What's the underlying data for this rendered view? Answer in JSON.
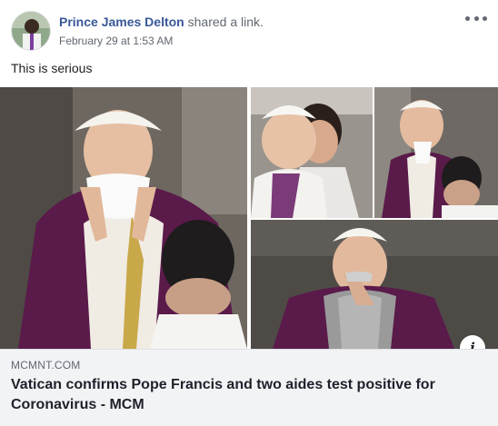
{
  "post": {
    "author": "Prince James Delton",
    "action": "shared a link.",
    "timestamp": "February 29 at 1:53 AM",
    "text": "This is serious",
    "more_icon": "ellipsis-icon"
  },
  "link": {
    "domain": "MCMNT.COM",
    "headline": "Vatican confirms Pope Francis and two aides test positive for Coronavirus - MCM",
    "info_icon": "i"
  },
  "colors": {
    "author_link": "#385898",
    "secondary_text": "#606770",
    "link_panel_bg": "#f2f3f5",
    "vestment_purple": "#5a1a4a"
  }
}
